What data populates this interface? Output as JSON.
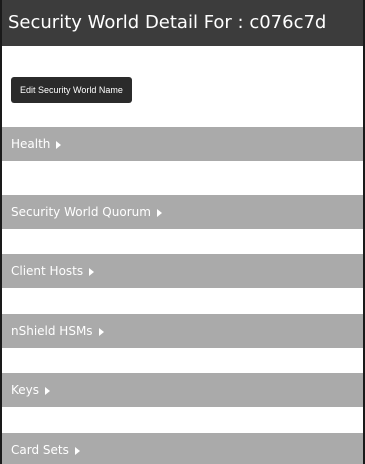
{
  "header": {
    "title": "Security World Detail For : c076c7d"
  },
  "actions": {
    "edit_name_label": "Edit Security World Name"
  },
  "sections": [
    {
      "label": "Health",
      "icon": "chevron-right-icon"
    },
    {
      "label": "Security World Quorum",
      "icon": "chevron-right-icon"
    },
    {
      "label": "Client Hosts",
      "icon": "chevron-right-icon"
    },
    {
      "label": "nShield HSMs",
      "icon": "chevron-right-icon"
    },
    {
      "label": "Keys",
      "icon": "chevron-right-icon"
    },
    {
      "label": "Card Sets",
      "icon": "chevron-right-icon"
    }
  ],
  "colors": {
    "title_bar": "#3c3c3c",
    "section_bar": "#aaaaaa",
    "button": "#2b2b2b"
  }
}
